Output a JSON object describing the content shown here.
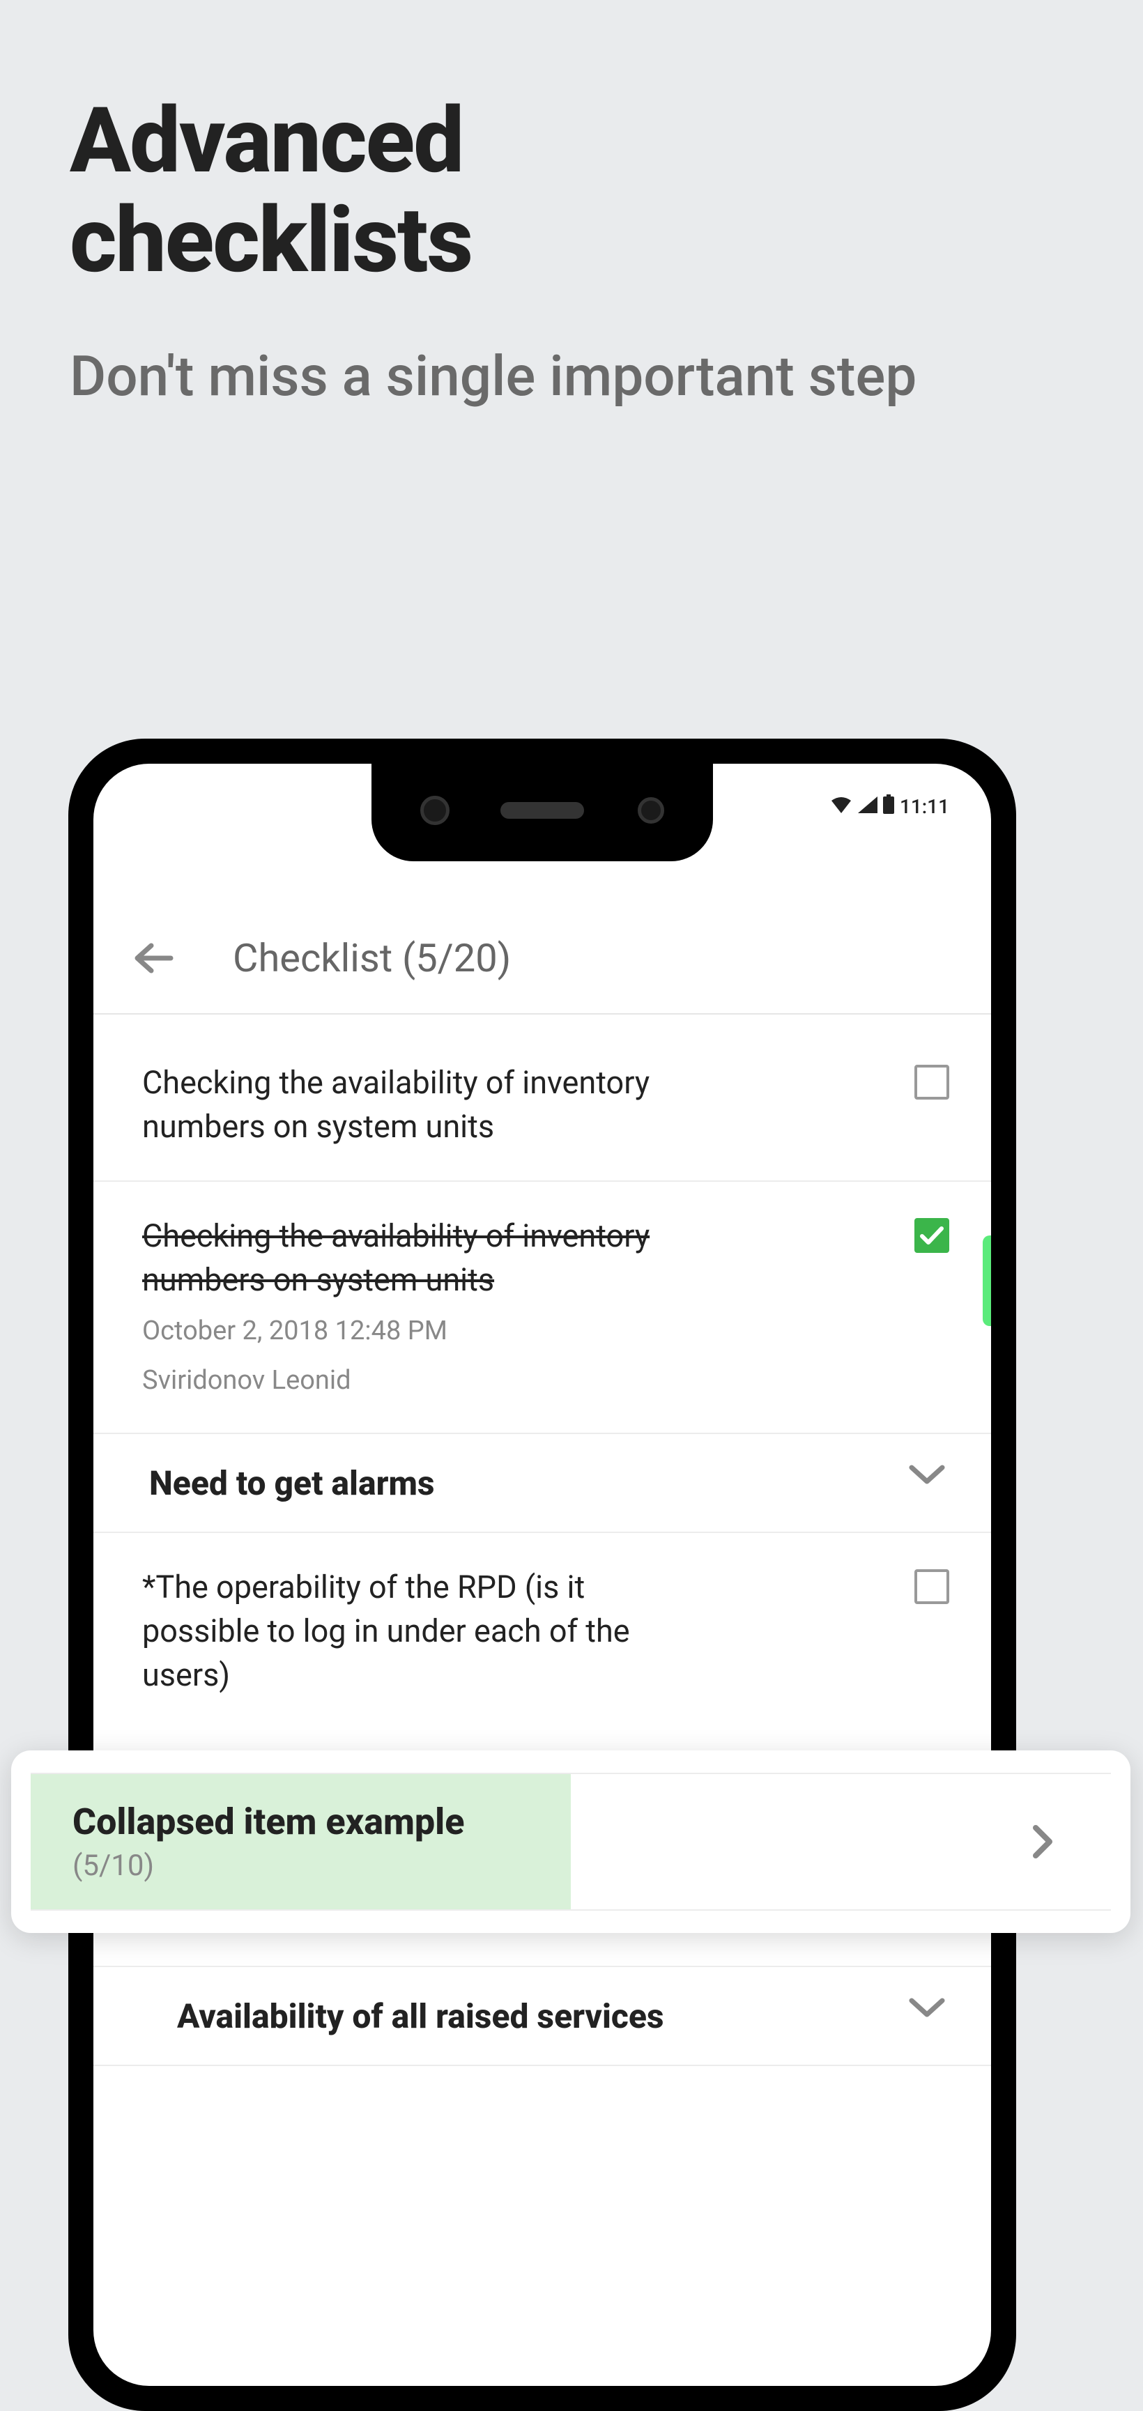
{
  "promo": {
    "title_l1": "Advanced",
    "title_l2": "checklists",
    "subtitle": "Don't miss a single important step"
  },
  "status": {
    "time": "11:11"
  },
  "header": {
    "title": "Checklist (5/20)"
  },
  "items": {
    "item1": {
      "text": "Checking the availability of inventory numbers on system units"
    },
    "item2": {
      "text": "Checking the availability of inventory numbers on system units",
      "date": "October 2, 2018 12:48 PM",
      "user": "Sviridonov Leonid"
    },
    "section1": {
      "title": "Need to get alarms"
    },
    "item3": {
      "text": "*The operability of the RPD (is it possible to log in under each of the users)"
    },
    "section2": {
      "title": "Availability of all raised services"
    }
  },
  "overlay": {
    "title": "Collapsed item example",
    "count": "(5/10)"
  }
}
